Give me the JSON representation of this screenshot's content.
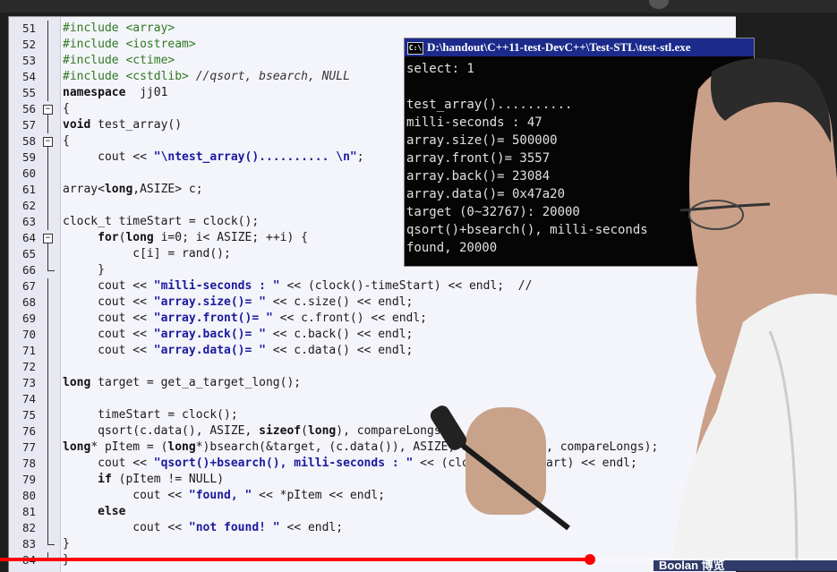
{
  "editor": {
    "lines": [
      {
        "num": "51",
        "fold": "",
        "html": [
          [
            "pp",
            "#include <array>"
          ]
        ]
      },
      {
        "num": "52",
        "fold": "",
        "html": [
          [
            "pp",
            "#include <iostream>"
          ]
        ]
      },
      {
        "num": "53",
        "fold": "",
        "html": [
          [
            "pp",
            "#include <ctime>"
          ]
        ]
      },
      {
        "num": "54",
        "fold": "",
        "html": [
          [
            "pp",
            "#include <cstdlib>"
          ],
          [
            "cm",
            " //qsort, bsearch, NULL"
          ]
        ]
      },
      {
        "num": "55",
        "fold": "",
        "html": [
          [
            "kw",
            "namespace"
          ],
          [
            "",
            "  jj01"
          ]
        ]
      },
      {
        "num": "56",
        "fold": "box",
        "html": [
          [
            "",
            "{"
          ]
        ]
      },
      {
        "num": "57",
        "fold": "",
        "html": [
          [
            "kw",
            "void"
          ],
          [
            "",
            " test_array()"
          ]
        ]
      },
      {
        "num": "58",
        "fold": "box",
        "html": [
          [
            "",
            "{"
          ]
        ]
      },
      {
        "num": "59",
        "fold": "",
        "html": [
          [
            "",
            "     cout << "
          ],
          [
            "str",
            "\"\\ntest_array().......... \\n\""
          ],
          [
            "",
            ";"
          ]
        ]
      },
      {
        "num": "60",
        "fold": "",
        "html": [
          [
            "",
            ""
          ]
        ]
      },
      {
        "num": "61",
        "fold": "",
        "html": [
          [
            "",
            "array<"
          ],
          [
            "kw",
            "long"
          ],
          [
            "",
            ",ASIZE> c;"
          ]
        ]
      },
      {
        "num": "62",
        "fold": "",
        "html": [
          [
            "",
            ""
          ]
        ]
      },
      {
        "num": "63",
        "fold": "",
        "html": [
          [
            "",
            "clock_t timeStart = clock();"
          ]
        ]
      },
      {
        "num": "64",
        "fold": "box",
        "html": [
          [
            "",
            "     "
          ],
          [
            "kw",
            "for"
          ],
          [
            "",
            "("
          ],
          [
            "kw",
            "long"
          ],
          [
            "",
            " i=0; i< ASIZE; ++i) {"
          ]
        ]
      },
      {
        "num": "65",
        "fold": "",
        "html": [
          [
            "",
            "          c[i] = rand();"
          ]
        ]
      },
      {
        "num": "66",
        "fold": "end",
        "html": [
          [
            "",
            "     }"
          ]
        ]
      },
      {
        "num": "67",
        "fold": "",
        "html": [
          [
            "",
            "     cout << "
          ],
          [
            "str",
            "\"milli-seconds : \""
          ],
          [
            "",
            " << (clock()-timeStart) << endl;  //"
          ]
        ]
      },
      {
        "num": "68",
        "fold": "",
        "html": [
          [
            "",
            "     cout << "
          ],
          [
            "str",
            "\"array.size()= \""
          ],
          [
            "",
            " << c.size() << endl;"
          ]
        ]
      },
      {
        "num": "69",
        "fold": "",
        "html": [
          [
            "",
            "     cout << "
          ],
          [
            "str",
            "\"array.front()= \""
          ],
          [
            "",
            " << c.front() << endl;"
          ]
        ]
      },
      {
        "num": "70",
        "fold": "",
        "html": [
          [
            "",
            "     cout << "
          ],
          [
            "str",
            "\"array.back()= \""
          ],
          [
            "",
            " << c.back() << endl;"
          ]
        ]
      },
      {
        "num": "71",
        "fold": "",
        "html": [
          [
            "",
            "     cout << "
          ],
          [
            "str",
            "\"array.data()= \""
          ],
          [
            "",
            " << c.data() << endl;"
          ]
        ]
      },
      {
        "num": "72",
        "fold": "",
        "html": [
          [
            "",
            ""
          ]
        ]
      },
      {
        "num": "73",
        "fold": "",
        "html": [
          [
            "kw",
            "long"
          ],
          [
            "",
            " target = get_a_target_long();"
          ]
        ]
      },
      {
        "num": "74",
        "fold": "",
        "html": [
          [
            "",
            ""
          ]
        ]
      },
      {
        "num": "75",
        "fold": "",
        "html": [
          [
            "",
            "     timeStart = clock();"
          ]
        ]
      },
      {
        "num": "76",
        "fold": "",
        "html": [
          [
            "",
            "     qsort(c.data(), ASIZE, "
          ],
          [
            "kw",
            "sizeof"
          ],
          [
            "",
            "("
          ],
          [
            "kw",
            "long"
          ],
          [
            "",
            "), compareLongs);"
          ]
        ]
      },
      {
        "num": "77",
        "fold": "",
        "html": [
          [
            "kw",
            "long"
          ],
          [
            "",
            "* pItem = ("
          ],
          [
            "kw",
            "long"
          ],
          [
            "",
            "*)bsearch(&target, (c.data()), ASIZE, "
          ],
          [
            "kw",
            "sizeof"
          ],
          [
            "",
            "("
          ],
          [
            "kw",
            "long"
          ],
          [
            "",
            "), compareLongs);"
          ]
        ]
      },
      {
        "num": "78",
        "fold": "",
        "html": [
          [
            "",
            "     cout << "
          ],
          [
            "str",
            "\"qsort()+bsearch(), milli-seconds : \""
          ],
          [
            "",
            " << (clock()-timeStart) << endl;"
          ]
        ]
      },
      {
        "num": "79",
        "fold": "",
        "html": [
          [
            "",
            "     "
          ],
          [
            "kw",
            "if"
          ],
          [
            "",
            " (pItem != NULL)"
          ]
        ]
      },
      {
        "num": "80",
        "fold": "",
        "html": [
          [
            "",
            "          cout << "
          ],
          [
            "str",
            "\"found, \""
          ],
          [
            "",
            " << *pItem << endl;"
          ]
        ]
      },
      {
        "num": "81",
        "fold": "",
        "html": [
          [
            "",
            "     "
          ],
          [
            "kw",
            "else"
          ]
        ]
      },
      {
        "num": "82",
        "fold": "",
        "html": [
          [
            "",
            "          cout << "
          ],
          [
            "str",
            "\"not found! \""
          ],
          [
            "",
            " << endl;"
          ]
        ]
      },
      {
        "num": "83",
        "fold": "end",
        "html": [
          [
            "",
            "}"
          ]
        ]
      },
      {
        "num": "84",
        "fold": "end",
        "html": [
          [
            "",
            "}"
          ]
        ]
      }
    ]
  },
  "console": {
    "title": "D:\\handout\\C++11-test-DevC++\\Test-STL\\test-stl.exe",
    "icon_label": "C:\\",
    "lines": [
      "select: 1",
      "",
      "test_array()..........",
      "milli-seconds : 47",
      "array.size()= 500000",
      "array.front()= 3557",
      "array.back()= 23084",
      "array.data()= 0x47a20",
      "target (0~32767): 20000",
      "qsort()+bsearch(), milli-seconds",
      "found, 20000"
    ]
  },
  "player": {
    "progress_fraction": 0.705
  },
  "watermark": {
    "text": "Boolan 博览"
  },
  "colors": {
    "preprocessor": "#2e7a1f",
    "string": "#1a1a9e",
    "console_title_bg": "#1c2a8c",
    "progress": "#ff0000"
  }
}
